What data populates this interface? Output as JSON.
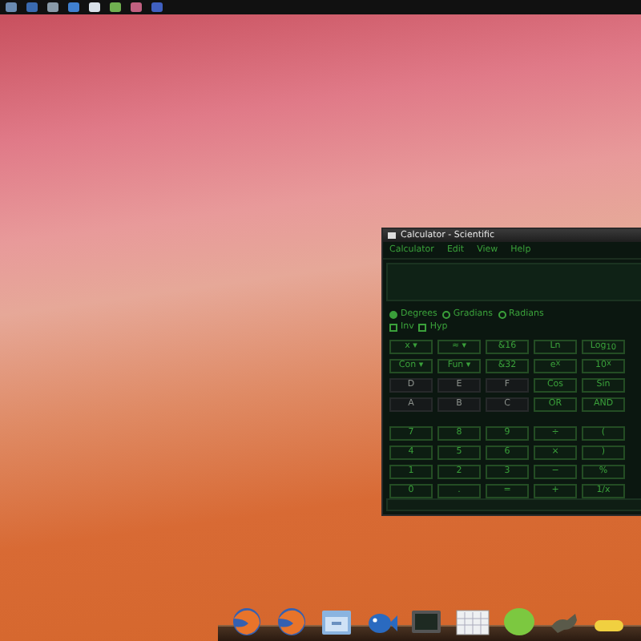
{
  "window": {
    "title": "Calculator - Scientific"
  },
  "menu": [
    {
      "label": "Calculator"
    },
    {
      "label": "Edit"
    },
    {
      "label": "View"
    },
    {
      "label": "Help"
    }
  ],
  "angle_units": [
    {
      "label": "Degrees",
      "selected": true
    },
    {
      "label": "Gradians",
      "selected": false
    },
    {
      "label": "Radians",
      "selected": false
    }
  ],
  "toggles": [
    {
      "label": "Inv",
      "checked": false
    },
    {
      "label": "Hyp",
      "checked": false
    }
  ],
  "function_rows": [
    [
      {
        "label": "x ▾",
        "disabled": false
      },
      {
        "label": "≈ ▾",
        "disabled": false
      },
      {
        "label": "&16",
        "disabled": false
      },
      {
        "label": "Ln",
        "disabled": false
      },
      {
        "label": "Log$_{10}$",
        "disabled": false
      }
    ],
    [
      {
        "label": "Con ▾",
        "disabled": false
      },
      {
        "label": "Fun ▾",
        "disabled": false
      },
      {
        "label": "&32",
        "disabled": false
      },
      {
        "label": "e$^{x}$",
        "disabled": false
      },
      {
        "label": "10$^{x}$",
        "disabled": false
      }
    ],
    [
      {
        "label": "D",
        "disabled": true
      },
      {
        "label": "E",
        "disabled": true
      },
      {
        "label": "F",
        "disabled": true
      },
      {
        "label": "Cos",
        "disabled": false
      },
      {
        "label": "Sin",
        "disabled": false
      }
    ],
    [
      {
        "label": "A",
        "disabled": true
      },
      {
        "label": "B",
        "disabled": true
      },
      {
        "label": "C",
        "disabled": true
      },
      {
        "label": "OR",
        "disabled": false
      },
      {
        "label": "AND",
        "disabled": false
      }
    ]
  ],
  "keypad_rows": [
    [
      {
        "label": "7"
      },
      {
        "label": "8"
      },
      {
        "label": "9"
      },
      {
        "label": "÷"
      },
      {
        "label": "("
      }
    ],
    [
      {
        "label": "4"
      },
      {
        "label": "5"
      },
      {
        "label": "6"
      },
      {
        "label": "×"
      },
      {
        "label": ")"
      }
    ],
    [
      {
        "label": "1"
      },
      {
        "label": "2"
      },
      {
        "label": "3"
      },
      {
        "label": "−"
      },
      {
        "label": "%"
      }
    ],
    [
      {
        "label": "0"
      },
      {
        "label": "."
      },
      {
        "label": "="
      },
      {
        "label": "+"
      },
      {
        "label": "1/x"
      }
    ]
  ]
}
